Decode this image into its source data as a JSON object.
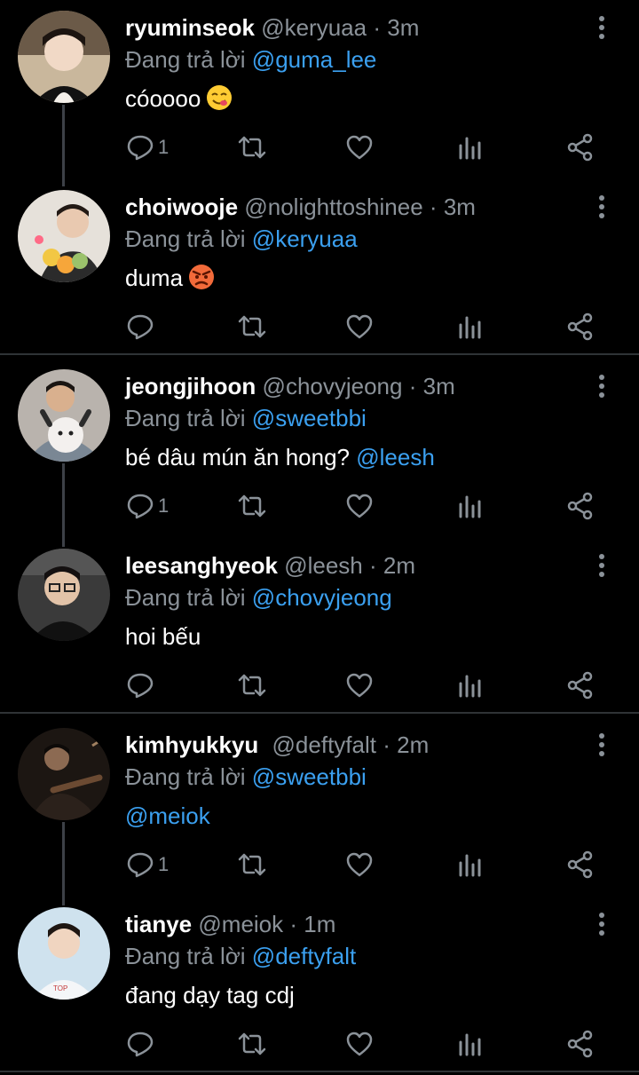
{
  "reply_prefix": "Đang trả lời",
  "tweets": [
    {
      "name": "ryuminseok",
      "handle": "@keryuaa",
      "sep": "·",
      "time": "3m",
      "reply_to": "@guma_lee",
      "text": "cóoooo",
      "emoji": "yum-emoji",
      "reply_count": "1"
    },
    {
      "name": "choiwooje",
      "handle": "@nolighttoshinee",
      "sep": "·",
      "time": "3m",
      "reply_to": "@keryuaa",
      "text": "duma",
      "emoji": "angry-emoji",
      "reply_count": ""
    },
    {
      "name": "jeongjihoon",
      "handle": "@chovyjeong",
      "sep": "·",
      "time": "3m",
      "reply_to": "@sweetbbi",
      "text": "bé dâu mún ăn hong?",
      "mention": "@leesh",
      "reply_count": "1"
    },
    {
      "name": "leesanghyeok",
      "handle": "@leesh",
      "sep": "·",
      "time": "2m",
      "reply_to": "@chovyjeong",
      "text": "hoi bếu",
      "reply_count": ""
    },
    {
      "name": "kimhyukkyu",
      "handle": "@deftyfalt",
      "sep": "·",
      "time": "2m",
      "reply_to": "@sweetbbi",
      "text": "",
      "mention": "@meiok",
      "reply_count": "1"
    },
    {
      "name": "tianye",
      "handle": "@meiok",
      "sep": "·",
      "time": "1m",
      "reply_to": "@deftyfalt",
      "text": "đang dạy tag cdj",
      "reply_count": ""
    }
  ],
  "icons": {
    "reply": "reply-icon",
    "retweet": "retweet-icon",
    "like": "heart-icon",
    "views": "views-icon",
    "share": "share-icon",
    "more": "more-vertical-icon"
  },
  "colors": {
    "background": "#000000",
    "mention": "#3ba0f0",
    "muted": "#8b9299",
    "divider": "#2f3336"
  }
}
